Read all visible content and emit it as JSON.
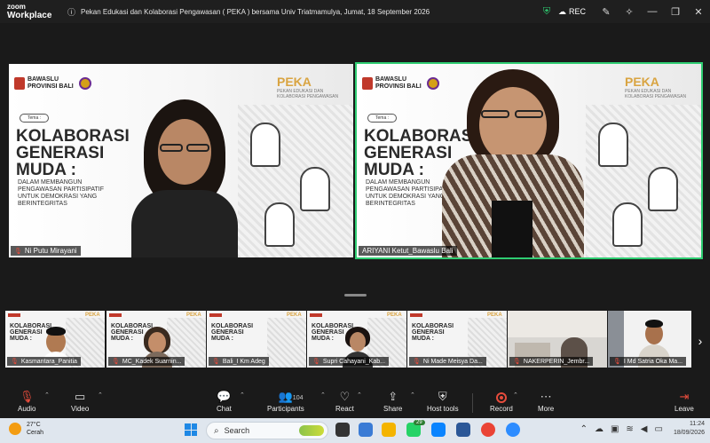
{
  "app": {
    "logo_top": "zoom",
    "logo_bottom": "Workplace"
  },
  "meeting": {
    "title": "Pekan Edukasi dan Kolaborasi Pengawasan ( PEKA ) bersama Univ Triatmamulya, Jumat, 18 September 2026"
  },
  "titlebar": {
    "rec_label": "REC"
  },
  "slide": {
    "org_line1": "BAWASLU",
    "org_line2": "PROVINSI BALI",
    "brand": "PEKA",
    "brand_sub": "PEKAN EDUKASI DAN KOLABORASI PENGAWASAN",
    "tema": "Tema :",
    "headline_1": "KOLABORASI",
    "headline_2": "GENERASI",
    "headline_3": "MUDA :",
    "sub_1": "DALAM MEMBANGUN",
    "sub_2": "PENGAWASAN PARTISIPATIF",
    "sub_3": "UNTUK DEMOKRASI YANG",
    "sub_4": "BERINTEGRITAS",
    "thumb_head_1": "KOLABORASI",
    "thumb_head_2": "GENERASI",
    "thumb_head_3": "MUDA :"
  },
  "speakers": [
    {
      "name": "Ni Putu Mirayani"
    },
    {
      "name": "ARIYANI Ketut_Bawaslu Bali"
    }
  ],
  "gallery": [
    {
      "name": "Kasmantara_Panitia"
    },
    {
      "name": "MC_Kadek Suarnin..."
    },
    {
      "name": "Bali_I Km Adeg"
    },
    {
      "name": "Supri Cahayani_Kab..."
    },
    {
      "name": "Ni Made Meisya Da..."
    },
    {
      "name": "NAKERPERIN_Jembr..."
    },
    {
      "name": "I Md Satria Oka Ma..."
    }
  ],
  "toolbar": {
    "audio": "Audio",
    "video": "Video",
    "chat": "Chat",
    "participants": "Participants",
    "participants_count": "104",
    "react": "React",
    "share": "Share",
    "host_tools": "Host tools",
    "record": "Record",
    "more": "More",
    "leave": "Leave"
  },
  "taskbar": {
    "temp": "27°C",
    "weather": "Cerah",
    "search_placeholder": "Search",
    "badge": "29",
    "time": "11:24",
    "date": "18/09/2026"
  },
  "colors": {
    "active_border": "#2ecc71",
    "accent_red": "#e74c3c",
    "peka_gold": "#d9a441"
  }
}
